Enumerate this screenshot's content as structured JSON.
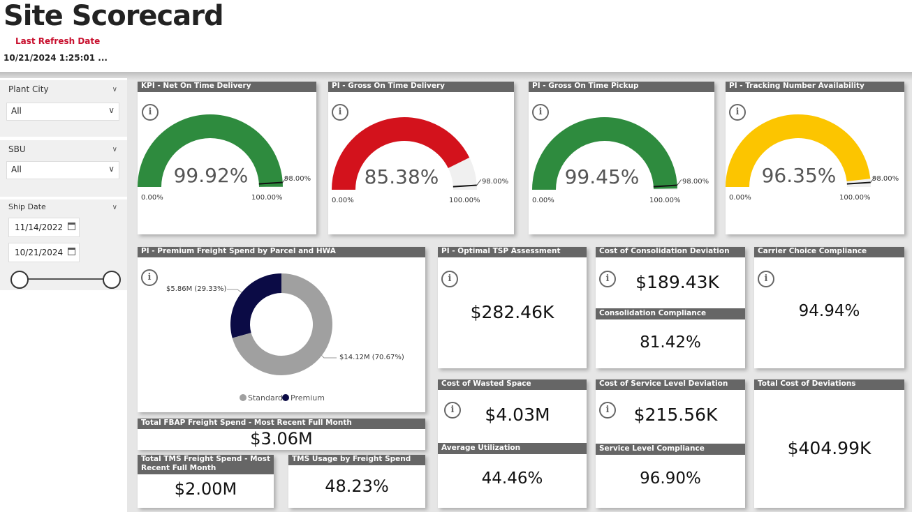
{
  "header": {
    "title": "Site Scorecard",
    "refresh_label": "Last Refresh Date",
    "refresh_value": "10/21/2024 1:25:01 ..."
  },
  "filters": {
    "plant_city": {
      "label": "Plant City",
      "value": "All"
    },
    "sbu": {
      "label": "SBU",
      "value": "All"
    },
    "ship_date": {
      "label": "Ship Date",
      "start": "11/14/2022",
      "end": "10/21/2024"
    }
  },
  "gauges": [
    {
      "title": "KPI - Net On Time Delivery",
      "value": "99.92%",
      "min": "0.00%",
      "max": "100.00%",
      "target": "98.00%",
      "fraction": 0.9992,
      "color": "#2e8b3e"
    },
    {
      "title": "PI - Gross On Time Delivery",
      "value": "85.38%",
      "min": "0.00%",
      "max": "100.00%",
      "target": "98.00%",
      "fraction": 0.8538,
      "color": "#d3121c"
    },
    {
      "title": "PI - Gross On Time Pickup",
      "value": "99.45%",
      "min": "0.00%",
      "max": "100.00%",
      "target": "98.00%",
      "fraction": 0.9945,
      "color": "#2e8b3e"
    },
    {
      "title": "PI - Tracking Number Availability",
      "value": "96.35%",
      "min": "0.00%",
      "max": "100.00%",
      "target": "98.00%",
      "fraction": 0.9635,
      "color": "#fcc500"
    }
  ],
  "donut": {
    "title": "PI - Premium Freight Spend by Parcel and HWA",
    "premium_label": "$5.86M (29.33%)",
    "standard_label": "$14.12M (70.67%)",
    "legend_standard": "Standard",
    "legend_premium": "Premium",
    "colors": {
      "standard": "#a0a0a0",
      "premium": "#0b0b45"
    },
    "chart_data": {
      "type": "pie",
      "categories": [
        "Premium",
        "Standard"
      ],
      "values": [
        29.33,
        70.67
      ]
    }
  },
  "kpis": {
    "fbap": {
      "title": "Total FBAP Freight Spend - Most Recent Full Month",
      "value": "$3.06M"
    },
    "tms_spend": {
      "title": "Total TMS Freight Spend - Most Recent Full Month",
      "value": "$2.00M"
    },
    "tms_usage": {
      "title": "TMS Usage by Freight Spend",
      "value": "48.23%"
    },
    "optimal_tsp": {
      "title": "PI - Optimal TSP Assessment",
      "value": "$282.46K"
    },
    "consolidation_dev": {
      "title": "Cost of Consolidation Deviation",
      "value": "$189.43K"
    },
    "consolidation_comp": {
      "title": "Consolidation Compliance",
      "value": "81.42%"
    },
    "carrier_choice": {
      "title": "Carrier Choice Compliance",
      "value": "94.94%"
    },
    "wasted_space": {
      "title": "Cost of Wasted Space",
      "value": "$4.03M"
    },
    "avg_util": {
      "title": "Average Utilization",
      "value": "44.46%"
    },
    "service_dev": {
      "title": "Cost of Service Level Deviation",
      "value": "$215.56K"
    },
    "service_comp": {
      "title": "Service Level Compliance",
      "value": "96.90%"
    },
    "total_dev": {
      "title": "Total Cost of Deviations",
      "value": "$404.99K"
    }
  }
}
